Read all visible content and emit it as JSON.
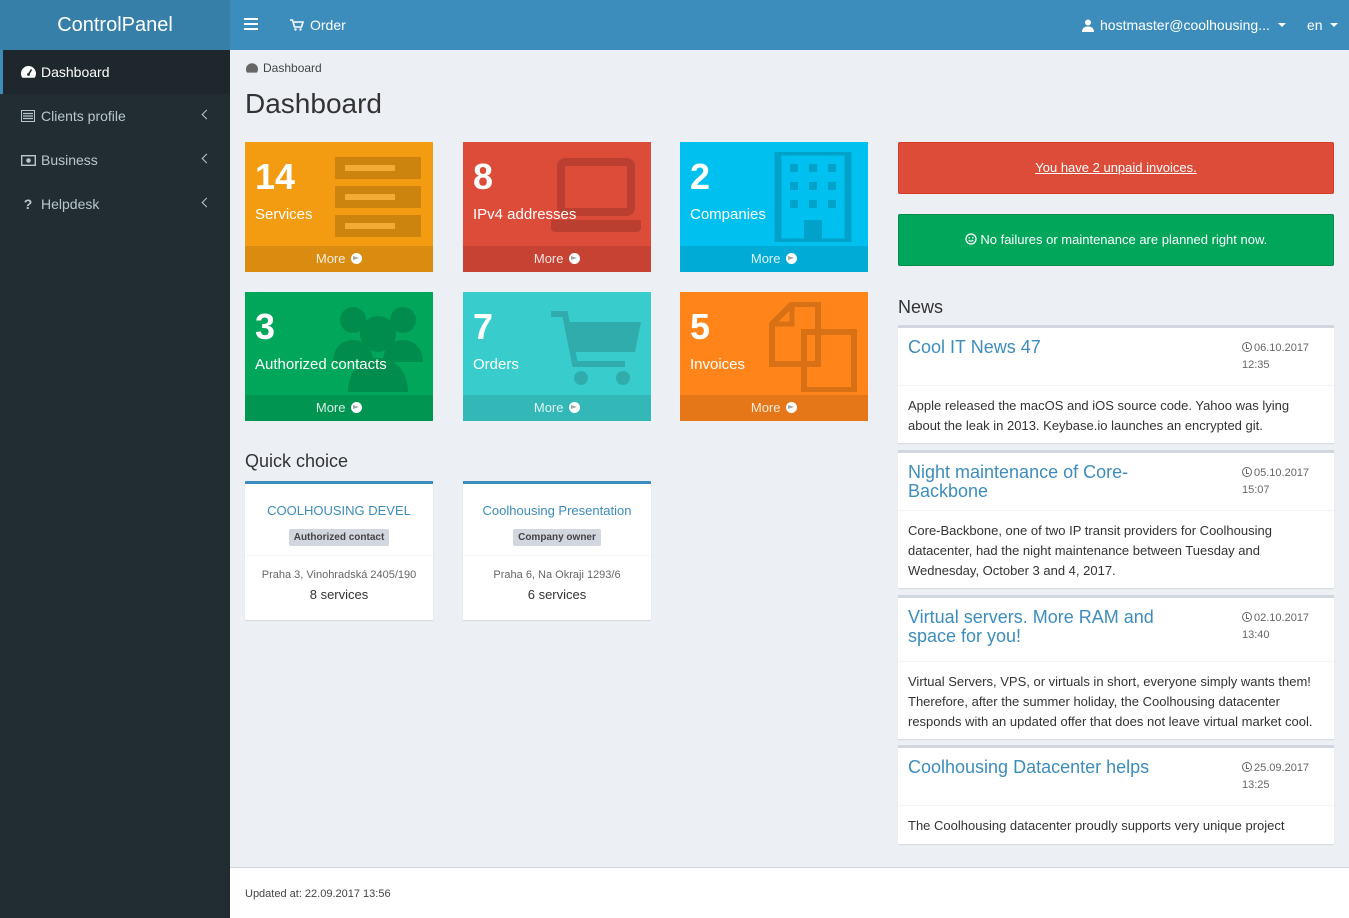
{
  "app": {
    "title": "ControlPanel"
  },
  "navbar": {
    "order_label": "Order",
    "user": "hostmaster@coolhousing...",
    "lang": "en"
  },
  "sidebar": {
    "items": [
      {
        "label": "Dashboard",
        "icon": "dashboard-icon"
      },
      {
        "label": "Clients profile",
        "icon": "list-icon"
      },
      {
        "label": "Business",
        "icon": "money-icon"
      },
      {
        "label": "Helpdesk",
        "icon": "question-icon"
      }
    ]
  },
  "breadcrumb": "Dashboard",
  "page_title": "Dashboard",
  "stats": [
    {
      "value": "14",
      "label": "Services",
      "more": "More",
      "color": "#f39c12",
      "icon": "server-icon"
    },
    {
      "value": "8",
      "label": "IPv4 addresses",
      "more": "More",
      "color": "#dd4b39",
      "icon": "laptop-icon"
    },
    {
      "value": "2",
      "label": "Companies",
      "more": "More",
      "color": "#00c0ef",
      "icon": "building-icon"
    },
    {
      "value": "3",
      "label": "Authorized contacts",
      "more": "More",
      "color": "#00a65a",
      "icon": "users-icon"
    },
    {
      "value": "7",
      "label": "Orders",
      "more": "More",
      "color": "#39cccc",
      "icon": "cart-icon"
    },
    {
      "value": "5",
      "label": "Invoices",
      "more": "More",
      "color": "#ff851b",
      "icon": "files-icon"
    }
  ],
  "quick_choice": {
    "title": "Quick choice",
    "items": [
      {
        "name": "COOLHOUSING DEVEL",
        "role": "Authorized contact",
        "address": "Praha 3, Vinohradská 2405/190",
        "services": "8 services"
      },
      {
        "name": "Coolhousing Presentation",
        "role": "Company owner",
        "address": "Praha 6, Na Okraji 1293/6",
        "services": "6 services"
      }
    ]
  },
  "alerts": {
    "unpaid": "You have 2 unpaid invoices.",
    "status": "No failures or maintenance are planned right now."
  },
  "news": {
    "title": "News",
    "items": [
      {
        "title": "Cool IT News 47",
        "date": "06.10.2017",
        "time": "12:35",
        "text": "Apple released the macOS and iOS source code. Yahoo was lying about the leak in 2013. Keybase.io launches an encrypted git."
      },
      {
        "title": "Night maintenance of Core-Backbone",
        "date": "05.10.2017",
        "time": "15:07",
        "text": "Core-Backbone, one of two IP transit providers for Coolhousing datacenter, had the night maintenance between Tuesday and Wednesday, October 3 and 4, 2017."
      },
      {
        "title": "Virtual servers. More RAM and space for you!",
        "date": "02.10.2017",
        "time": "13:40",
        "text": "Virtual Servers, VPS, or virtuals in short, everyone simply wants them! Therefore, after the summer holiday, the Coolhousing datacenter responds with an updated offer that does not leave virtual market cool."
      },
      {
        "title": "Coolhousing Datacenter helps",
        "date": "25.09.2017",
        "time": "13:25",
        "text": "The Coolhousing datacenter proudly supports very unique project"
      }
    ]
  },
  "footer": {
    "updated": "Updated at: 22.09.2017 13:56"
  }
}
